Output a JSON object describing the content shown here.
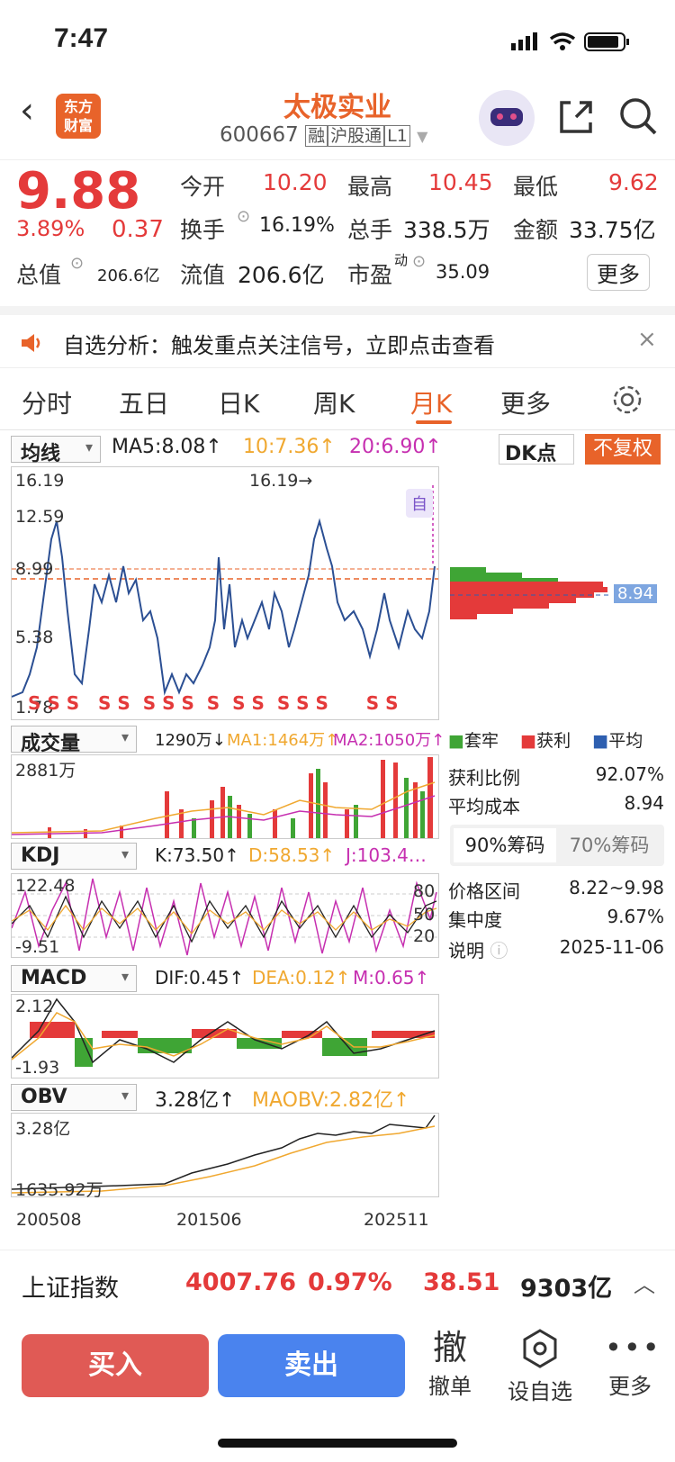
{
  "status": {
    "time": "7:47"
  },
  "header": {
    "logo_line1": "东方",
    "logo_line2": "财富",
    "title": "太极实业",
    "code": "600667",
    "badge_rong": "融",
    "badge_hgt": "沪股通",
    "badge_l1": "L1"
  },
  "quote": {
    "price": "9.88",
    "pct": "3.89%",
    "chg": "0.37",
    "open_label": "今开",
    "open": "10.20",
    "high_label": "最高",
    "high": "10.45",
    "low_label": "最低",
    "low": "9.62",
    "turnover_label": "换手",
    "turnover": "16.19%",
    "vol_label": "总手",
    "vol": "338.5万",
    "amt_label": "金额",
    "amt": "33.75亿",
    "mcap_label": "总值",
    "mcap": "206.6亿",
    "float_label": "流值",
    "float": "206.6亿",
    "pe_label": "市盈",
    "pe_sup": "动",
    "pe": "35.09",
    "more": "更多"
  },
  "notice": {
    "text": "自选分析：触发重点关注信号，立即点击查看"
  },
  "tabs": [
    "分时",
    "五日",
    "日K",
    "周K",
    "月K",
    "更多"
  ],
  "active_tab": "月K",
  "ma": {
    "select": "均线",
    "ma5": "MA5:8.08↑",
    "ma10": "10:7.36↑",
    "ma20": "20:6.90↑",
    "dk": "DK点",
    "fq": "不复权",
    "c_ma10": "#f0a830",
    "c_ma20": "#c62fb0"
  },
  "main_chart": {
    "y1": "16.19",
    "y2": "12.59",
    "y3": "8.99",
    "y4": "5.38",
    "y5": "1.78",
    "peak": "16.19→",
    "self": "自",
    "s_marks": "S S S   S S  S S S  S  S S  S S S      S S",
    "cost_tag": "8.94"
  },
  "volume": {
    "select": "成交量",
    "v": "1290万↓",
    "ma1": "MA1:1464万↑",
    "ma2": "MA2:1050万↑",
    "ymax": "2881万"
  },
  "kdj": {
    "select": "KDJ",
    "k": "K:73.50↑",
    "d": "D:58.53↑",
    "j": "J:103.4…",
    "ymax": "122.48",
    "ymin": "-9.51",
    "l80": "80",
    "l50": "50",
    "l20": "20"
  },
  "macd": {
    "select": "MACD",
    "dif": "DIF:0.45↑",
    "dea": "DEA:0.12↑",
    "m": "M:0.65↑",
    "ymax": "2.12",
    "ymin": "-1.93"
  },
  "obv": {
    "select": "OBV",
    "v": "3.28亿↑",
    "ma": "MAOBV:2.82亿↑",
    "ymax": "3.28亿",
    "ymin": "1635.92万"
  },
  "xaxis": [
    "200508",
    "201506",
    "202511"
  ],
  "chips": {
    "legend_tao": "套牢",
    "legend_huo": "获利",
    "legend_avg": "平均",
    "profit_label": "获利比例",
    "profit": "92.07%",
    "avg_label": "平均成本",
    "avg": "8.94",
    "tab90": "90%筹码",
    "tab70": "70%筹码",
    "range_label": "价格区间",
    "range": "8.22~9.98",
    "conc_label": "集中度",
    "conc": "9.67%",
    "note_label": "说明",
    "note": "2025-11-06"
  },
  "index": {
    "name": "上证指数",
    "val": "4007.76",
    "pct": "0.97%",
    "chg": "38.51",
    "amt": "9303亿"
  },
  "actions": {
    "buy": "买入",
    "sell": "卖出",
    "cancel_icon": "撤",
    "cancel": "撤单",
    "fav": "设自选",
    "more": "更多"
  },
  "colors": {
    "red": "#e43a3a",
    "green": "#3fa535",
    "orange": "#e8632a",
    "blue": "#2e5fb0"
  }
}
